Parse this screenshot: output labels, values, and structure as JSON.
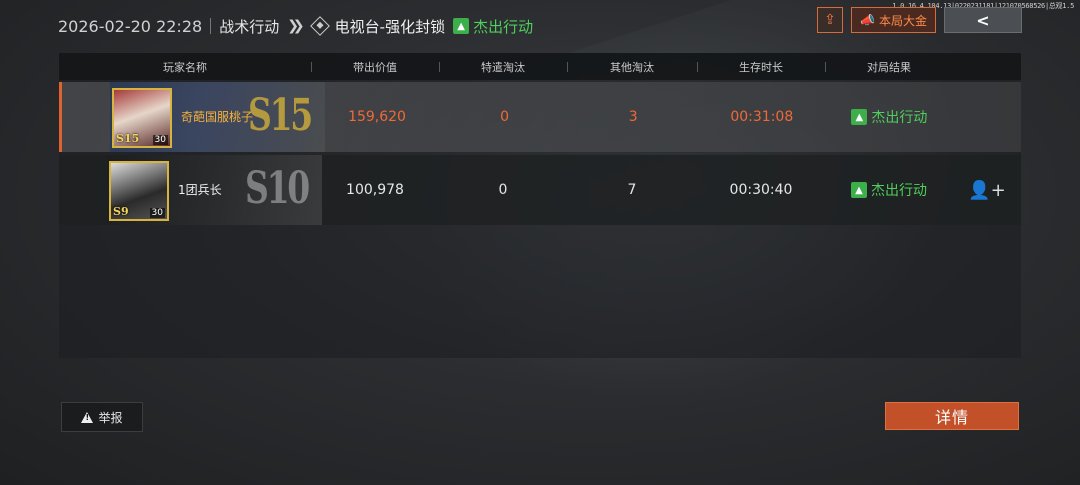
{
  "build_info": "1.0.16.4.104.13|0220231181|121070568526|总观1.5",
  "header": {
    "datetime": "2026-02-20 22:28",
    "mode": "战术行动",
    "map": "电视台-强化封锁",
    "result": "杰出行动"
  },
  "top_buttons": {
    "share_icon": "share-icon",
    "loudspeaker_label": "本局大金",
    "back_icon": "chevron-left-icon"
  },
  "table": {
    "headers": [
      "玩家名称",
      "带出价值",
      "特遣淘汰",
      "其他淘汰",
      "生存时长",
      "对局结果"
    ],
    "rows": [
      {
        "name": "奇葩国服桃子",
        "season": "S15",
        "avatar_season": "S15",
        "level": "30",
        "value": "159,620",
        "special_kills": "0",
        "other_kills": "3",
        "survival": "00:31:08",
        "result": "杰出行动",
        "is_self": true
      },
      {
        "name": "1团兵长",
        "season": "S10",
        "avatar_season": "S9",
        "level": "30",
        "value": "100,978",
        "special_kills": "0",
        "other_kills": "7",
        "survival": "00:30:40",
        "result": "杰出行动",
        "is_self": false
      }
    ]
  },
  "footer": {
    "report_label": "举报",
    "details_label": "详情"
  },
  "colors": {
    "accent_orange": "#c2512a",
    "self_text": "#ef6a35",
    "success_green": "#4fcf5c",
    "gold": "#d7b340"
  }
}
